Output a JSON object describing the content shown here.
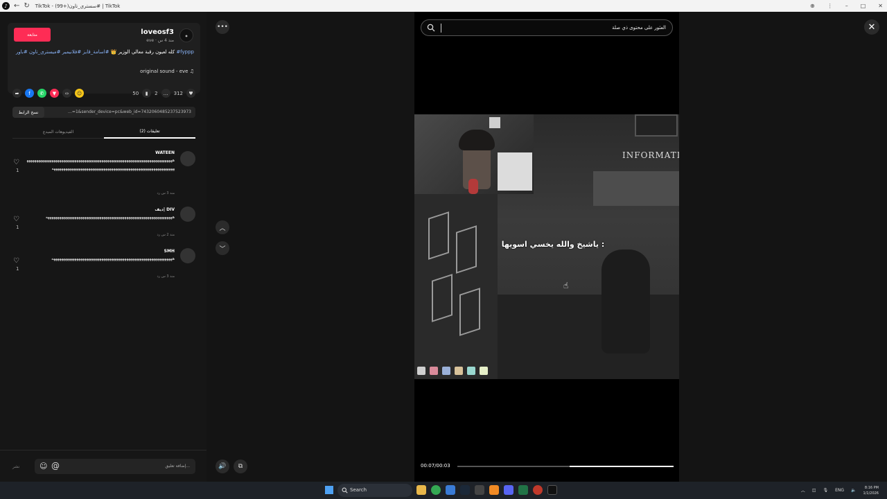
{
  "window": {
    "title": "TikTok - (99+)سستري_تاون# | TikTok",
    "min": "–",
    "max": "□",
    "close": "✕"
  },
  "post": {
    "follow_label": "متابعة",
    "author_name": "loveosf3",
    "author_meta": "eve · منذ 4 س",
    "avatar_text": "a\nicon",
    "caption_text": "كله لعيون رقبة معالي الوزير 👑",
    "caption_tags": "#اسامة_قايز #فلانيمير #ميستري_تاون #باور #fyppp",
    "sound": "original sound - eve ♫",
    "likes": "312",
    "comments": "2",
    "saves": "50"
  },
  "share": {
    "copy_label": "نسخ الرابط",
    "url": "…=1&sender_device=pc&web_id=7432060485237523973"
  },
  "tabs": {
    "comments_label": "تعليقات (2)",
    "creator_videos_label": "الفيديوهات المبدع"
  },
  "comments": [
    {
      "user": "WATEEN",
      "text": "ههههههههههههههههههههههههههههههههههههههههههههههههههههههههههههههههههههههههههههههههههههههههههههههههههههههههههههههههههههههههههههههههههههههههههههه",
      "meta": "منذ 3 س    رد",
      "likes": "1"
    },
    {
      "user": "ديف| DIV",
      "text": "ههههههههههههههههههههههههههههههههههههههههههههههههههههههههههههههههههه",
      "meta": "منذ 2 س    رد",
      "likes": "1"
    },
    {
      "user": "SMH",
      "text": "هههههههههههههههههههههههههههههههههههههههههههههههههههههههههههههههه",
      "meta": "منذ 3 س    رد",
      "likes": "1"
    }
  ],
  "composer": {
    "post_label": "نشر",
    "placeholder": "إضافة تعليق..."
  },
  "nav": {
    "more": "•••",
    "up": "︿",
    "down": "﹀",
    "volume": "🔊",
    "pip": "⧉"
  },
  "player": {
    "search_text": "العثور على محتوى ذي صلة",
    "subtitle": "ياشيخ والله يخسي اسويها :",
    "info_sign": "INFORMATIO",
    "time": "00:07/00:03",
    "progress": 0.48,
    "close": "✕"
  },
  "taskbar": {
    "search_label": "Search",
    "lang": "ENG",
    "time": "8:16 PM",
    "date": "1/1/2026"
  },
  "colors": {
    "accent": "#fe2c55",
    "link": "#8ab4f8"
  }
}
